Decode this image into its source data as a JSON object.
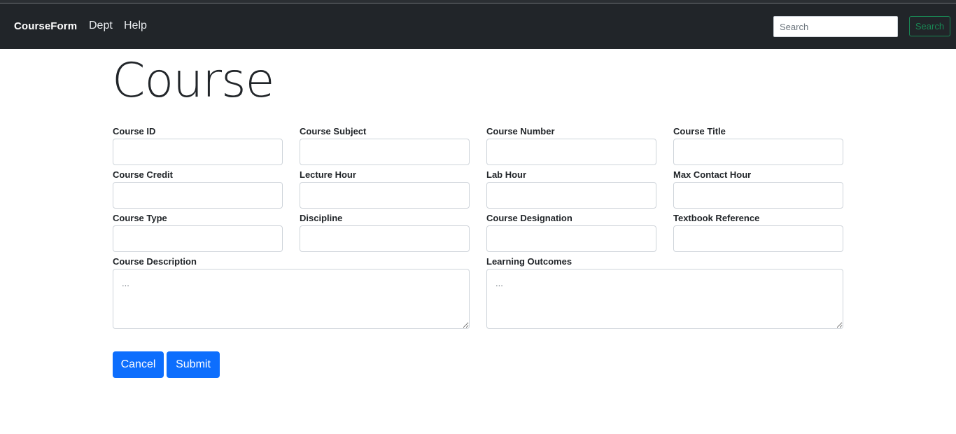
{
  "navbar": {
    "brand": "CourseForm",
    "links": [
      "Dept",
      "Help"
    ],
    "search_placeholder": "Search",
    "search_button": "Search"
  },
  "page": {
    "title": "Course"
  },
  "form": {
    "fields": [
      {
        "label": "Course ID",
        "value": ""
      },
      {
        "label": "Course Subject",
        "value": ""
      },
      {
        "label": "Course Number",
        "value": ""
      },
      {
        "label": "Course Title",
        "value": ""
      },
      {
        "label": "Course Credit",
        "value": ""
      },
      {
        "label": "Lecture Hour",
        "value": ""
      },
      {
        "label": "Lab Hour",
        "value": ""
      },
      {
        "label": "Max Contact Hour",
        "value": ""
      },
      {
        "label": "Course Type",
        "value": ""
      },
      {
        "label": "Discipline",
        "value": ""
      },
      {
        "label": "Course Designation",
        "value": ""
      },
      {
        "label": "Textbook Reference",
        "value": ""
      }
    ],
    "textareas": [
      {
        "label": "Course Description",
        "placeholder": "..."
      },
      {
        "label": "Learning Outcomes",
        "placeholder": "..."
      }
    ],
    "buttons": {
      "cancel": "Cancel",
      "submit": "Submit"
    }
  },
  "colors": {
    "navbar_bg": "#212529",
    "primary": "#0d6efd",
    "success_outline": "#198754"
  }
}
